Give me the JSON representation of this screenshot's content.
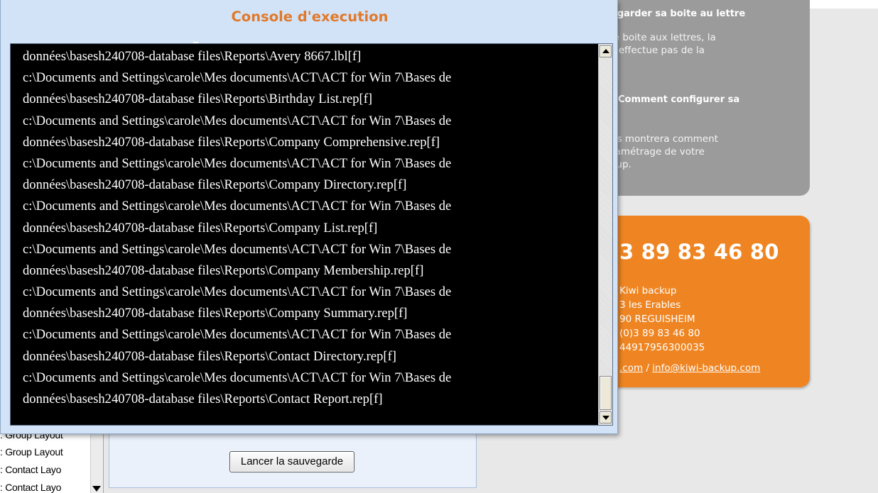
{
  "background": {
    "gray_box": {
      "heading": "egarder sa boite au lettre",
      "text1": [
        "le boite aux lettres, la",
        " s'effectue pas de la",
        "."
      ],
      "heading2": "Comment configurer sa",
      "text2": [
        "us montrera comment",
        "ramétrage de votre",
        "kup."
      ]
    },
    "orange_box": {
      "phone": "3 89 83 46 80",
      "address_lines": [
        "Kiwi backup",
        "3 les Erables",
        "90 REGUISHEIM",
        "(0)3 89 83 46 80",
        " 44917956300035"
      ],
      "link1": ".com",
      "separator": " / ",
      "link2": "info@kiwi-backup.com"
    },
    "left_list": {
      "items": [
        "Group Layout",
        "Group Layout",
        "Contact Layo",
        "Contact Layo"
      ]
    },
    "lancer_button": "Lancer la sauvegarde"
  },
  "console": {
    "title": "Console d'execution",
    "lines": [
      "données\\basesh240708-database files\\Reports\\Avery 8667.lbl[f]",
      "c:\\Documents and Settings\\carole\\Mes documents\\ACT\\ACT for Win 7\\Bases de",
      "données\\basesh240708-database files\\Reports\\Birthday List.rep[f]",
      "c:\\Documents and Settings\\carole\\Mes documents\\ACT\\ACT for Win 7\\Bases de",
      "données\\basesh240708-database files\\Reports\\Company Comprehensive.rep[f]",
      "c:\\Documents and Settings\\carole\\Mes documents\\ACT\\ACT for Win 7\\Bases de",
      "données\\basesh240708-database files\\Reports\\Company Directory.rep[f]",
      "c:\\Documents and Settings\\carole\\Mes documents\\ACT\\ACT for Win 7\\Bases de",
      "données\\basesh240708-database files\\Reports\\Company List.rep[f]",
      "c:\\Documents and Settings\\carole\\Mes documents\\ACT\\ACT for Win 7\\Bases de",
      "données\\basesh240708-database files\\Reports\\Company Membership.rep[f]",
      "c:\\Documents and Settings\\carole\\Mes documents\\ACT\\ACT for Win 7\\Bases de",
      "données\\basesh240708-database files\\Reports\\Company Summary.rep[f]",
      "c:\\Documents and Settings\\carole\\Mes documents\\ACT\\ACT for Win 7\\Bases de",
      "données\\basesh240708-database files\\Reports\\Contact Directory.rep[f]",
      "c:\\Documents and Settings\\carole\\Mes documents\\ACT\\ACT for Win 7\\Bases de",
      "données\\basesh240708-database files\\Reports\\Contact Report.rep[f]"
    ]
  },
  "icons": {
    "scroll_up": "arrow-up-icon",
    "scroll_down": "arrow-down-icon",
    "dropdown": "chevron-down-icon"
  },
  "colors": {
    "title_orange": "#e0792b",
    "contact_orange": "#ef8522",
    "info_gray": "#9b9b9b",
    "console_bg": "#000000",
    "window_bg": "#d3e3f7"
  }
}
